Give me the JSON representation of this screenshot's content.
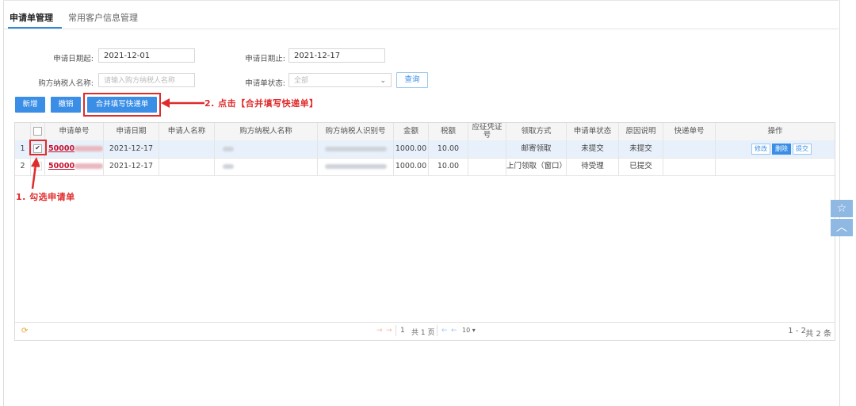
{
  "tabs": [
    {
      "label": "申请单管理"
    },
    {
      "label": "常用客户信息管理"
    }
  ],
  "filters": {
    "date_from_label": "申请日期起:",
    "date_from_value": "2021-12-01",
    "date_to_label": "申请日期止:",
    "date_to_value": "2021-12-17",
    "buyer_label": "购方纳税人名称:",
    "buyer_placeholder": "请输入购方纳税人名称",
    "status_label": "申请单状态:",
    "status_value": "全部",
    "query_label": "查询"
  },
  "toolbar": {
    "add_label": "新增",
    "revoke_label": "撤销",
    "merge_label": "合并填写快递单"
  },
  "annotations": {
    "step2": "2. 点击【合并填写快递单】",
    "step1": "1. 勾选申请单"
  },
  "table": {
    "headers": [
      "申请单号",
      "申请日期",
      "申请人名称",
      "购方纳税人名称",
      "购方纳税人识别号",
      "金额",
      "税额",
      "应征凭证号",
      "领取方式",
      "申请单状态",
      "原因说明",
      "快递单号",
      "操作"
    ],
    "rows": [
      {
        "index": "1",
        "app_no": "50000",
        "date": "2021-12-17",
        "amount": "1000.00",
        "tax": "10.00",
        "pickup": "邮寄领取",
        "status": "未提交",
        "reason": "未提交",
        "ops": [
          "修改",
          "删除",
          "提交"
        ]
      },
      {
        "index": "2",
        "app_no": "50000",
        "date": "2021-12-17",
        "amount": "1000.00",
        "tax": "10.00",
        "pickup": "上门领取（窗口）",
        "status": "待受理",
        "reason": "已提交",
        "ops": []
      }
    ]
  },
  "pager": {
    "page_input": "1",
    "total_pages": "共 1 页",
    "page_size": "10",
    "range": "1 - 2",
    "total": "共 2 条"
  },
  "colors": {
    "accent": "#3a8ee6",
    "annotation": "#e02b2b"
  },
  "icons": [
    "refresh-icon",
    "star-icon",
    "chevron-up-icon"
  ]
}
